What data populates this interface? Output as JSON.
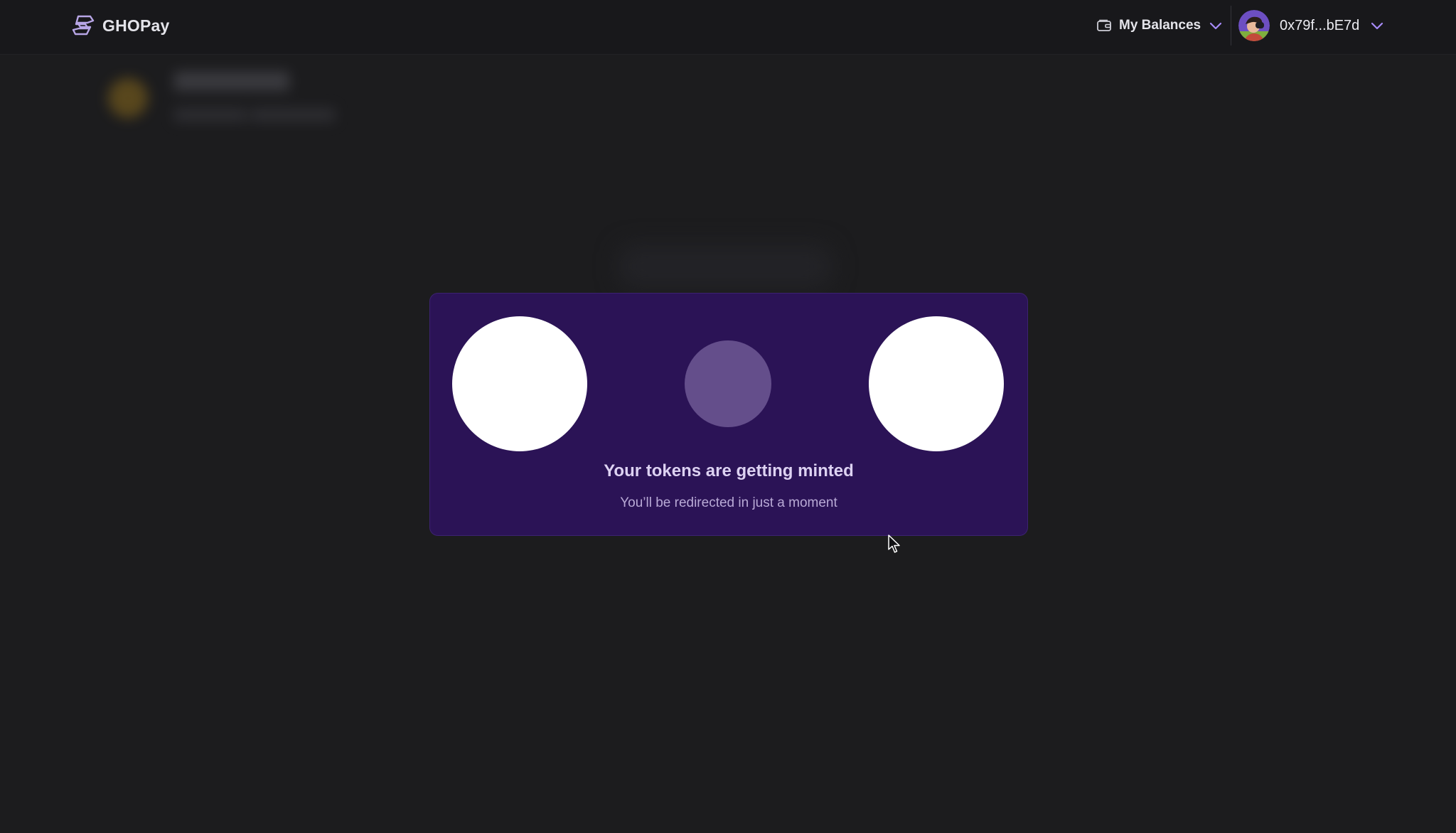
{
  "header": {
    "brand_name": "GHOPay",
    "balances_label": "My Balances",
    "account_address": "0x79f...bE7d"
  },
  "modal": {
    "title": "Your tokens are getting minted",
    "subtitle": "You’ll be redirected in just a moment"
  },
  "icons": {
    "brand_logo": "ghopay-logo-icon",
    "wallet": "wallet-icon",
    "balances_chevron": "chevron-down-icon",
    "account_chevron": "chevron-down-icon",
    "cursor": "mouse-cursor-icon"
  },
  "colors": {
    "background": "#1c1c1e",
    "topbar": "#18181b",
    "modal_background": "#2b1356",
    "accent_purple": "#a78bfa",
    "loader_active": "#ffffff",
    "loader_dim": "#644e8b"
  }
}
